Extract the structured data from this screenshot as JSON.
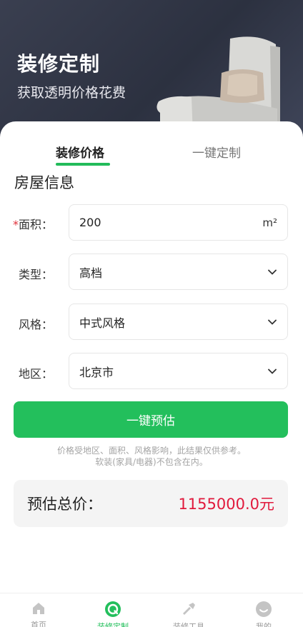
{
  "hero": {
    "title": "装修定制",
    "subtitle": "获取透明价格花费"
  },
  "tabs": [
    {
      "label": "装修价格",
      "active": true
    },
    {
      "label": "一键定制",
      "active": false
    }
  ],
  "section_title": "房屋信息",
  "form": {
    "area": {
      "label": "面积：",
      "required_mark": "*",
      "value": "200",
      "unit": "m²"
    },
    "type": {
      "label": "类型：",
      "value": "高档",
      "icon": "chevron-down-icon"
    },
    "style": {
      "label": "风格：",
      "value": "中式风格",
      "icon": "chevron-down-icon"
    },
    "region": {
      "label": "地区：",
      "value": "北京市",
      "icon": "chevron-down-icon"
    }
  },
  "estimate_button": "一键预估",
  "notes": [
    "价格受地区、面积、风格影响，此结果仅供参考。",
    "软装(家具/电器)不包含在内。"
  ],
  "total": {
    "label": "预估总价：",
    "value": "1155000.0元"
  },
  "bottom_nav": [
    {
      "label": "首页",
      "icon": "home-icon",
      "active": false
    },
    {
      "label": "装修定制",
      "icon": "custom-icon",
      "active": true
    },
    {
      "label": "装修工具",
      "icon": "tools-icon",
      "active": false
    },
    {
      "label": "我的",
      "icon": "profile-icon",
      "active": false
    }
  ],
  "colors": {
    "accent": "#23bf5c",
    "price": "#e1193c",
    "hero_bg": "#2f3444",
    "required": "#e0303a"
  }
}
